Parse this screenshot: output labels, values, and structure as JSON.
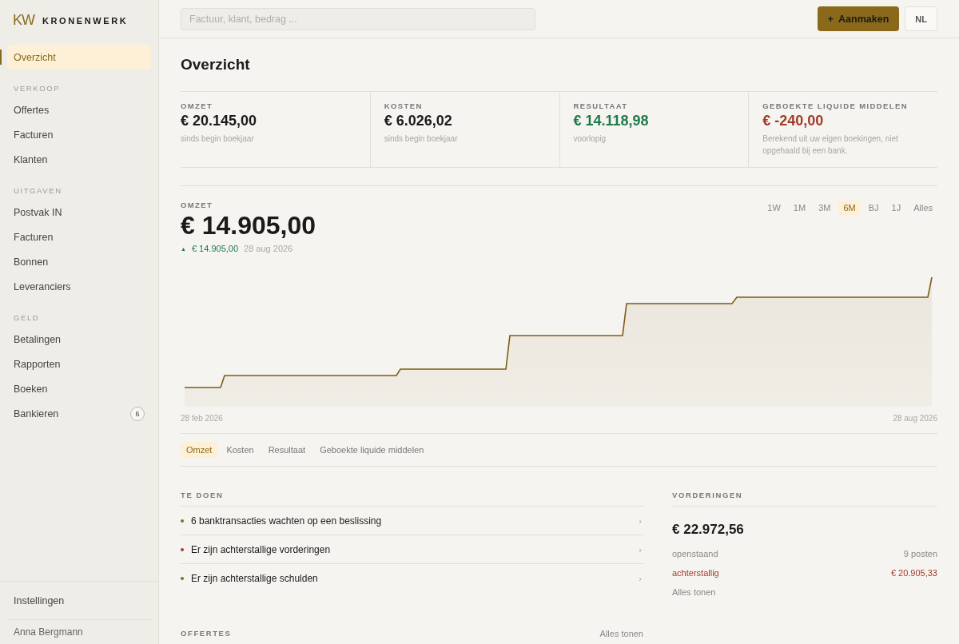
{
  "brand": {
    "mark": "KW",
    "name": "KRONENWERK"
  },
  "sidebar": {
    "top_items": [
      {
        "label": "Overzicht",
        "selected": true
      }
    ],
    "sections": [
      {
        "heading": "VERKOOP",
        "items": [
          {
            "label": "Offertes",
            "selected": false
          },
          {
            "label": "Facturen",
            "selected": false
          },
          {
            "label": "Klanten",
            "selected": false
          }
        ]
      },
      {
        "heading": "UITGAVEN",
        "items": [
          {
            "label": "Postvak IN",
            "selected": false
          },
          {
            "label": "Facturen",
            "selected": false
          },
          {
            "label": "Bonnen",
            "selected": false
          },
          {
            "label": "Leveranciers",
            "selected": false
          }
        ]
      },
      {
        "heading": "GELD",
        "items": [
          {
            "label": "Betalingen",
            "selected": false
          },
          {
            "label": "Rapporten",
            "selected": false
          },
          {
            "label": "Boeken",
            "selected": false
          },
          {
            "label": "Bankieren",
            "selected": false,
            "badge": "6"
          }
        ]
      }
    ],
    "footer_items": [
      {
        "label": "Instellingen",
        "selected": false
      }
    ],
    "user": "Anna Bergmann"
  },
  "topbar": {
    "search": {
      "placeholder": "Factuur, klant, bedrag ..."
    },
    "create_button": {
      "icon": "+",
      "label": "Aanmaken"
    },
    "language": "NL"
  },
  "title": "Overzicht",
  "kpis": [
    {
      "label": "OMZET",
      "value": "€ 20.145,00",
      "note": "sinds begin boekjaar",
      "color": "#1a1a1a"
    },
    {
      "label": "KOSTEN",
      "value": "€ 6.026,02",
      "note": "sinds begin boekjaar",
      "color": "#1a1a1a"
    },
    {
      "label": "RESULTAAT",
      "value": "€ 14.118,98",
      "note": "voorlopig",
      "color": "#1f7a4a"
    },
    {
      "label": "GEBOEKTE LIQUIDE MIDDELEN",
      "value": "€ -240,00",
      "note": "Berekend uit uw eigen boekingen, niet opgehaald bij een bank.",
      "color": "#a33a2a"
    }
  ],
  "revenue": {
    "label": "OMZET",
    "value": "€ 14.905,00",
    "trend_icon": "▲",
    "delta": "€ 14.905,00",
    "date": "28 aug 2026",
    "ranges": [
      {
        "label": "1W",
        "selected": false
      },
      {
        "label": "1M",
        "selected": false
      },
      {
        "label": "3M",
        "selected": false
      },
      {
        "label": "6M",
        "selected": true
      },
      {
        "label": "BJ",
        "selected": false
      },
      {
        "label": "1J",
        "selected": false
      },
      {
        "label": "Alles",
        "selected": false
      }
    ],
    "start_date": "28 feb 2026",
    "end_date": "28 aug 2026",
    "metric_tabs": [
      {
        "label": "Omzet",
        "selected": true
      },
      {
        "label": "Kosten",
        "selected": false
      },
      {
        "label": "Resultaat",
        "selected": false
      },
      {
        "label": "Geboekte liquide middelen",
        "selected": false
      }
    ]
  },
  "todo": {
    "title": "TE DOEN",
    "items": [
      {
        "text": "6 banktransacties wachten op een beslissing",
        "color": "#8a6a1a",
        "chevron": "›"
      },
      {
        "text": "Er zijn achterstallige vorderingen",
        "color": "#a33a2a",
        "chevron": "›"
      },
      {
        "text": "Er zijn achterstallige schulden",
        "color": "#8a6a1a",
        "chevron": "›"
      }
    ]
  },
  "receivables": {
    "title": "VORDERINGEN",
    "total": "€ 22.972,56",
    "rows": [
      {
        "label": "openstaand",
        "value": "9 posten",
        "color": "#8a8a88"
      },
      {
        "label": "achterstallig",
        "value": "€ 20.905,33",
        "color": "#a33a2a"
      }
    ],
    "link": "Alles tonen"
  },
  "quotes": {
    "title": "OFFERTES",
    "link": "Alles tonen"
  }
}
